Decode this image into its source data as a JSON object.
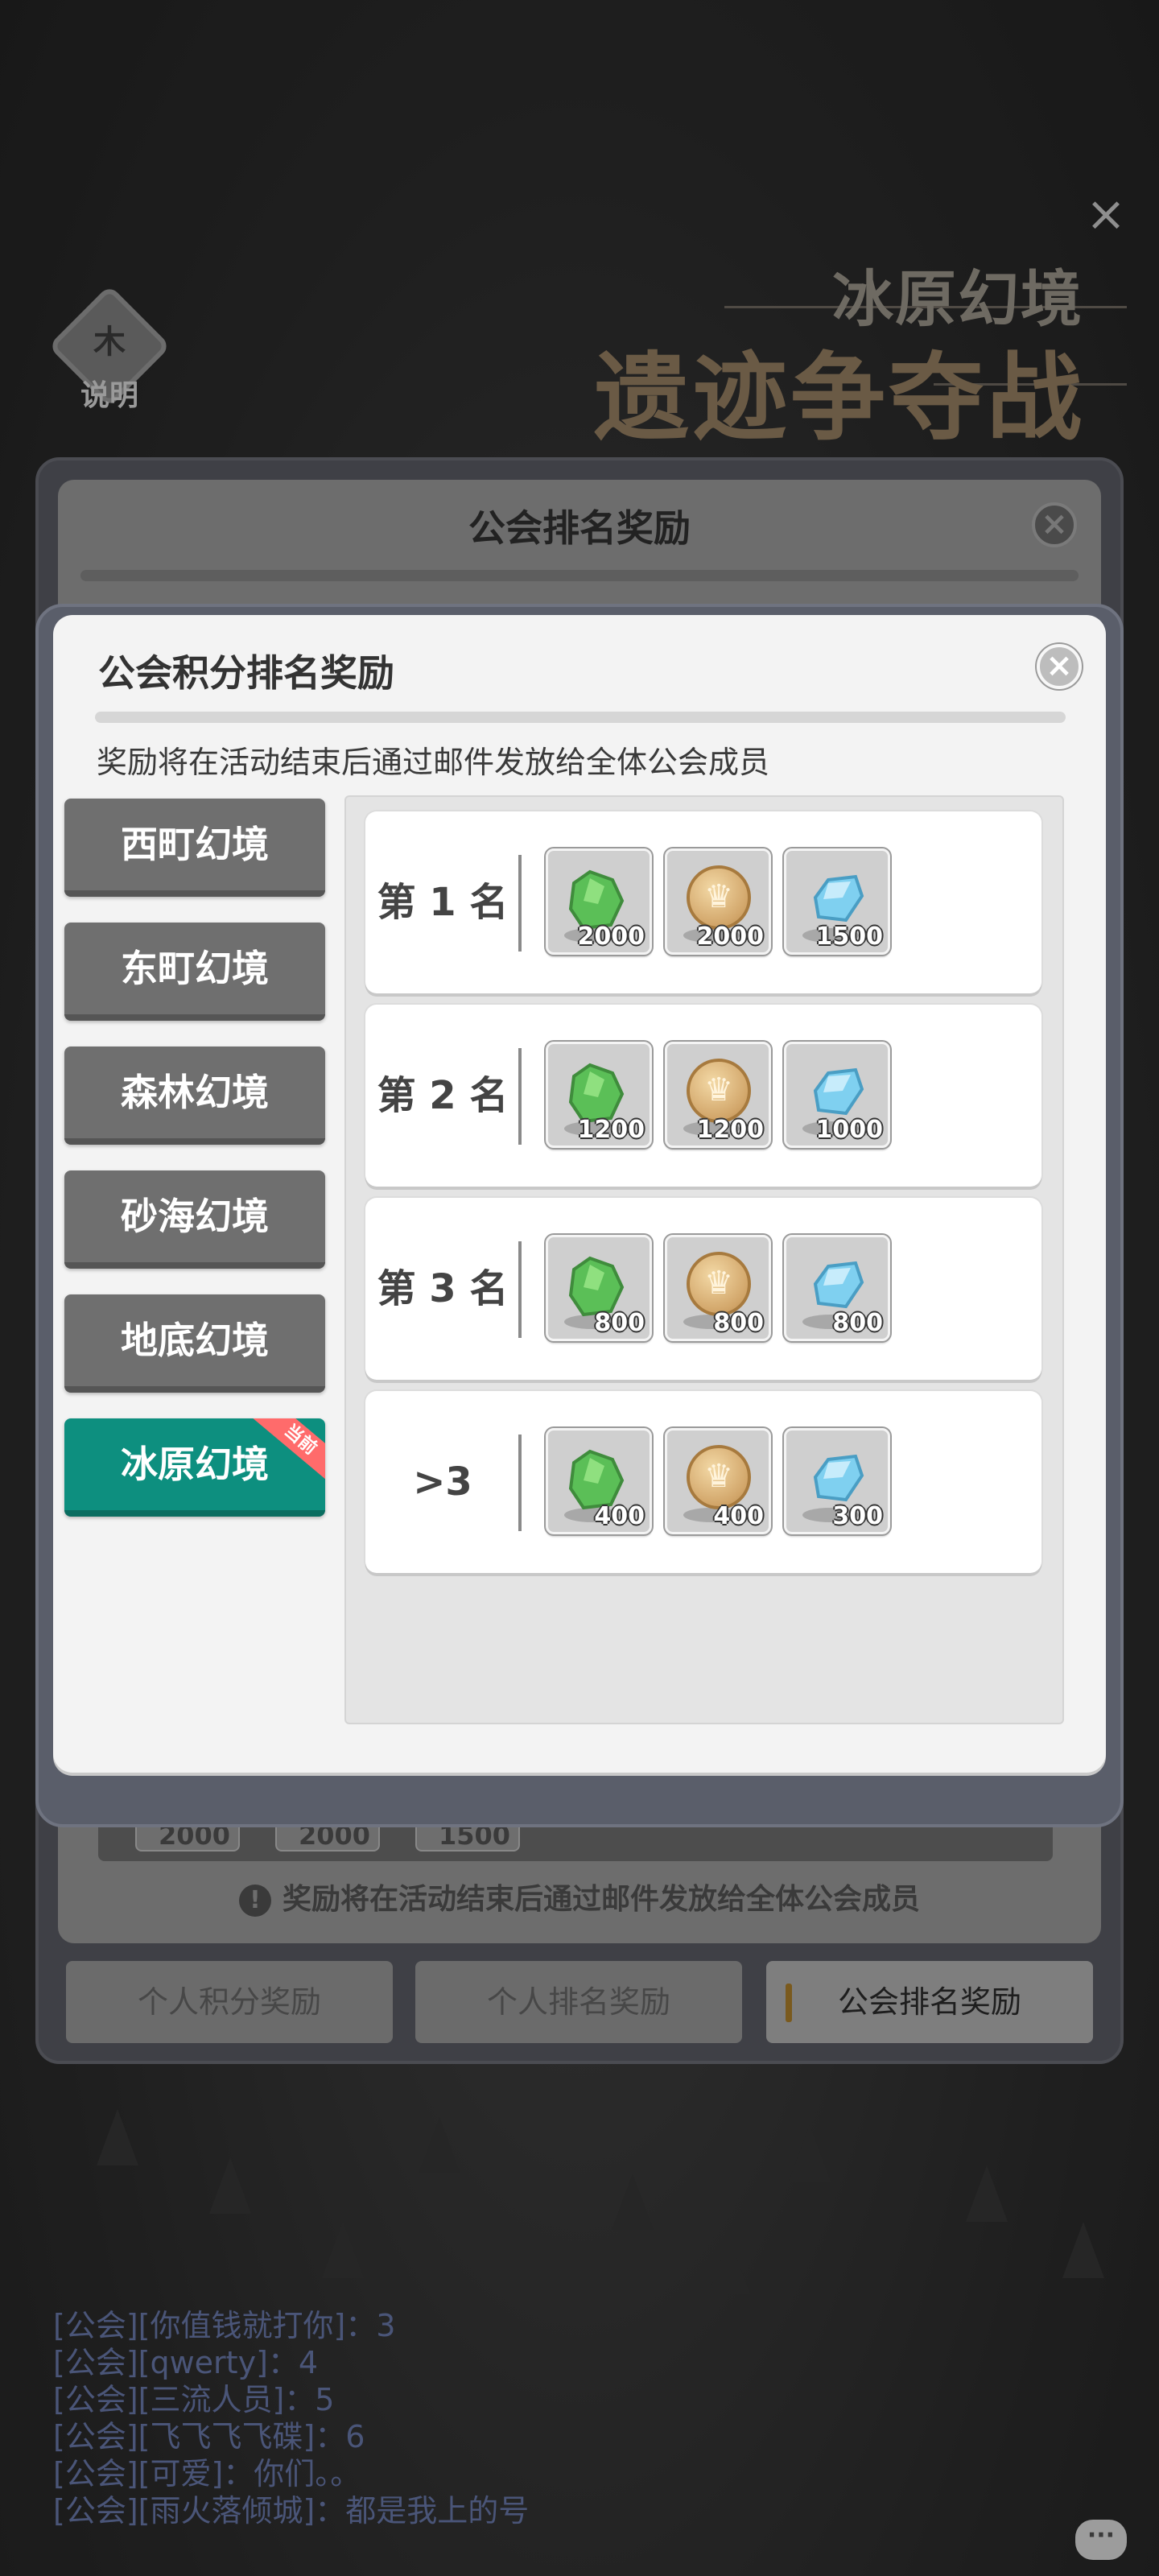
{
  "header": {
    "close_glyph": "×",
    "help_glyph": "木",
    "help_label": "说明",
    "event_subtitle": "冰原幻境",
    "event_title": "遗迹争夺战"
  },
  "back_dialog": {
    "title": "公会排名奖励",
    "close_glyph": "×",
    "chips": [
      "2000",
      "2000",
      "1500"
    ],
    "warn_glyph": "!",
    "note": "奖励将在活动结束后通过邮件发放给全体公会成员",
    "tabs": [
      {
        "label": "个人积分奖励"
      },
      {
        "label": "个人排名奖励"
      },
      {
        "label": "公会排名奖励"
      }
    ]
  },
  "dialog": {
    "title": "公会积分排名奖励",
    "close_glyph": "×",
    "note": "奖励将在活动结束后通过邮件发放给全体公会成员",
    "regions": [
      {
        "label": "西町幻境"
      },
      {
        "label": "东町幻境"
      },
      {
        "label": "森林幻境"
      },
      {
        "label": "砂海幻境"
      },
      {
        "label": "地底幻境"
      },
      {
        "label": "冰原幻境",
        "badge": "当前"
      }
    ],
    "ranks": [
      {
        "label": "第 1 名",
        "items": [
          {
            "icon": "green-crystal-icon",
            "qty": "2000"
          },
          {
            "icon": "crown-coin-icon",
            "qty": "2000"
          },
          {
            "icon": "blue-gem-icon",
            "qty": "1500"
          }
        ]
      },
      {
        "label": "第 2 名",
        "items": [
          {
            "icon": "green-crystal-icon",
            "qty": "1200"
          },
          {
            "icon": "crown-coin-icon",
            "qty": "1200"
          },
          {
            "icon": "blue-gem-icon",
            "qty": "1000"
          }
        ]
      },
      {
        "label": "第 3 名",
        "items": [
          {
            "icon": "green-crystal-icon",
            "qty": "800"
          },
          {
            "icon": "crown-coin-icon",
            "qty": "800"
          },
          {
            "icon": "blue-gem-icon",
            "qty": "800"
          }
        ]
      },
      {
        "label": ">3",
        "items": [
          {
            "icon": "green-crystal-icon",
            "qty": "400"
          },
          {
            "icon": "crown-coin-icon",
            "qty": "400"
          },
          {
            "icon": "blue-gem-icon",
            "qty": "300"
          }
        ]
      }
    ]
  },
  "chat": {
    "lines": [
      "[公会][你值钱就打你]：3",
      "[公会][qwerty]：4",
      "[公会][三流人员]：5",
      "[公会][飞飞飞飞碟]：6",
      "[公会][可爱]：你们。。",
      "[公会][雨火落倾城]：都是我上的号"
    ],
    "icon_glyph": "···"
  },
  "colors": {
    "accent_active": "#0d8f7f",
    "badge": "#ff6b6b",
    "chat_text": "#4a5578"
  }
}
